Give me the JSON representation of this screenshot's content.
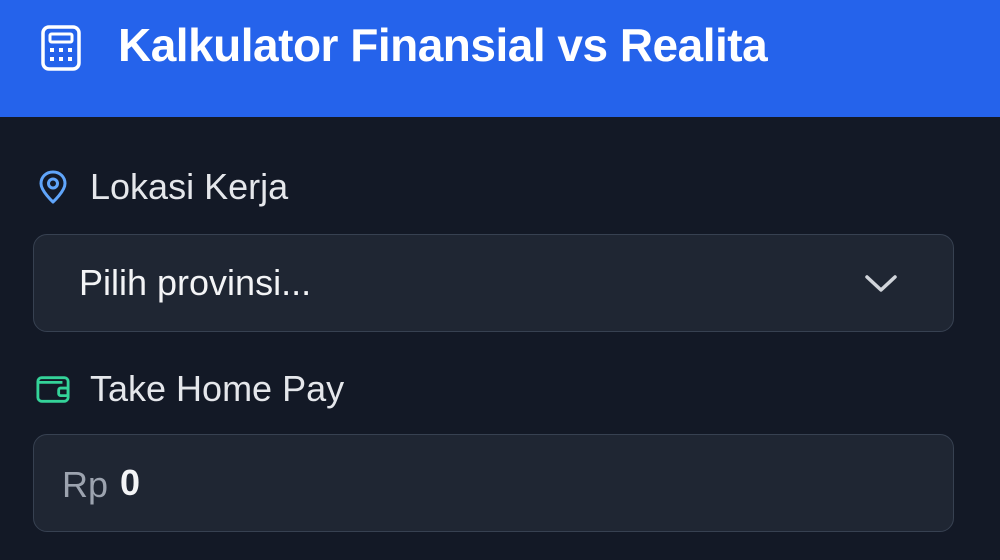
{
  "header": {
    "title": "Kalkulator Finansial vs Realita",
    "icon": "calculator-icon"
  },
  "form": {
    "location": {
      "label": "Lokasi Kerja",
      "icon": "map-pin-icon",
      "selected_value": "Pilih provinsi..."
    },
    "take_home_pay": {
      "label": "Take Home Pay",
      "icon": "wallet-icon",
      "prefix": "Rp",
      "value": "0"
    }
  },
  "colors": {
    "header_bg": "#2563EB",
    "page_bg": "#131926",
    "input_bg": "#1F2633",
    "location_icon": "#60A5FA",
    "wallet_icon": "#34D399"
  }
}
